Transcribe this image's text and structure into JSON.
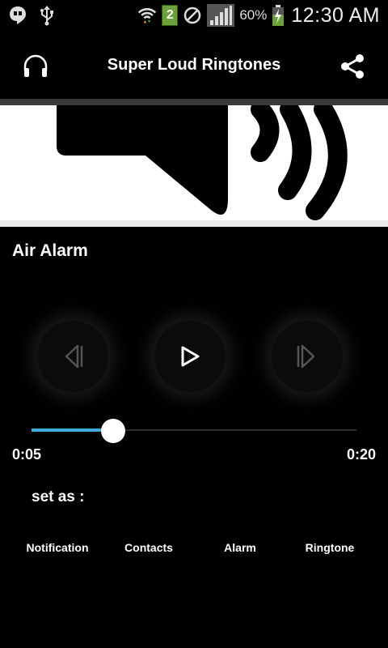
{
  "status_bar": {
    "icons": [
      "hangouts-icon",
      "usb-icon",
      "wifi-icon",
      "sim-2-icon",
      "do-not-disturb-icon",
      "signal-icon",
      "battery-charging-icon"
    ],
    "sim_badge": "2",
    "battery_percent": "60%",
    "time": "12:30 AM"
  },
  "toolbar": {
    "title": "Super Loud Ringtones",
    "left_icon": "headphones-icon",
    "right_icon": "share-icon"
  },
  "banner": {
    "icon": "speaker-icon"
  },
  "player": {
    "track_title": "Air Alarm",
    "controls": [
      "previous-icon",
      "play-icon",
      "next-icon"
    ],
    "progress": 0.25,
    "current_time": "0:05",
    "total_time": "0:20",
    "accent_color": "#3fa9dc"
  },
  "set_as": {
    "label": "set as :",
    "options": [
      "Notification",
      "Contacts",
      "Alarm",
      "Ringtone"
    ]
  }
}
